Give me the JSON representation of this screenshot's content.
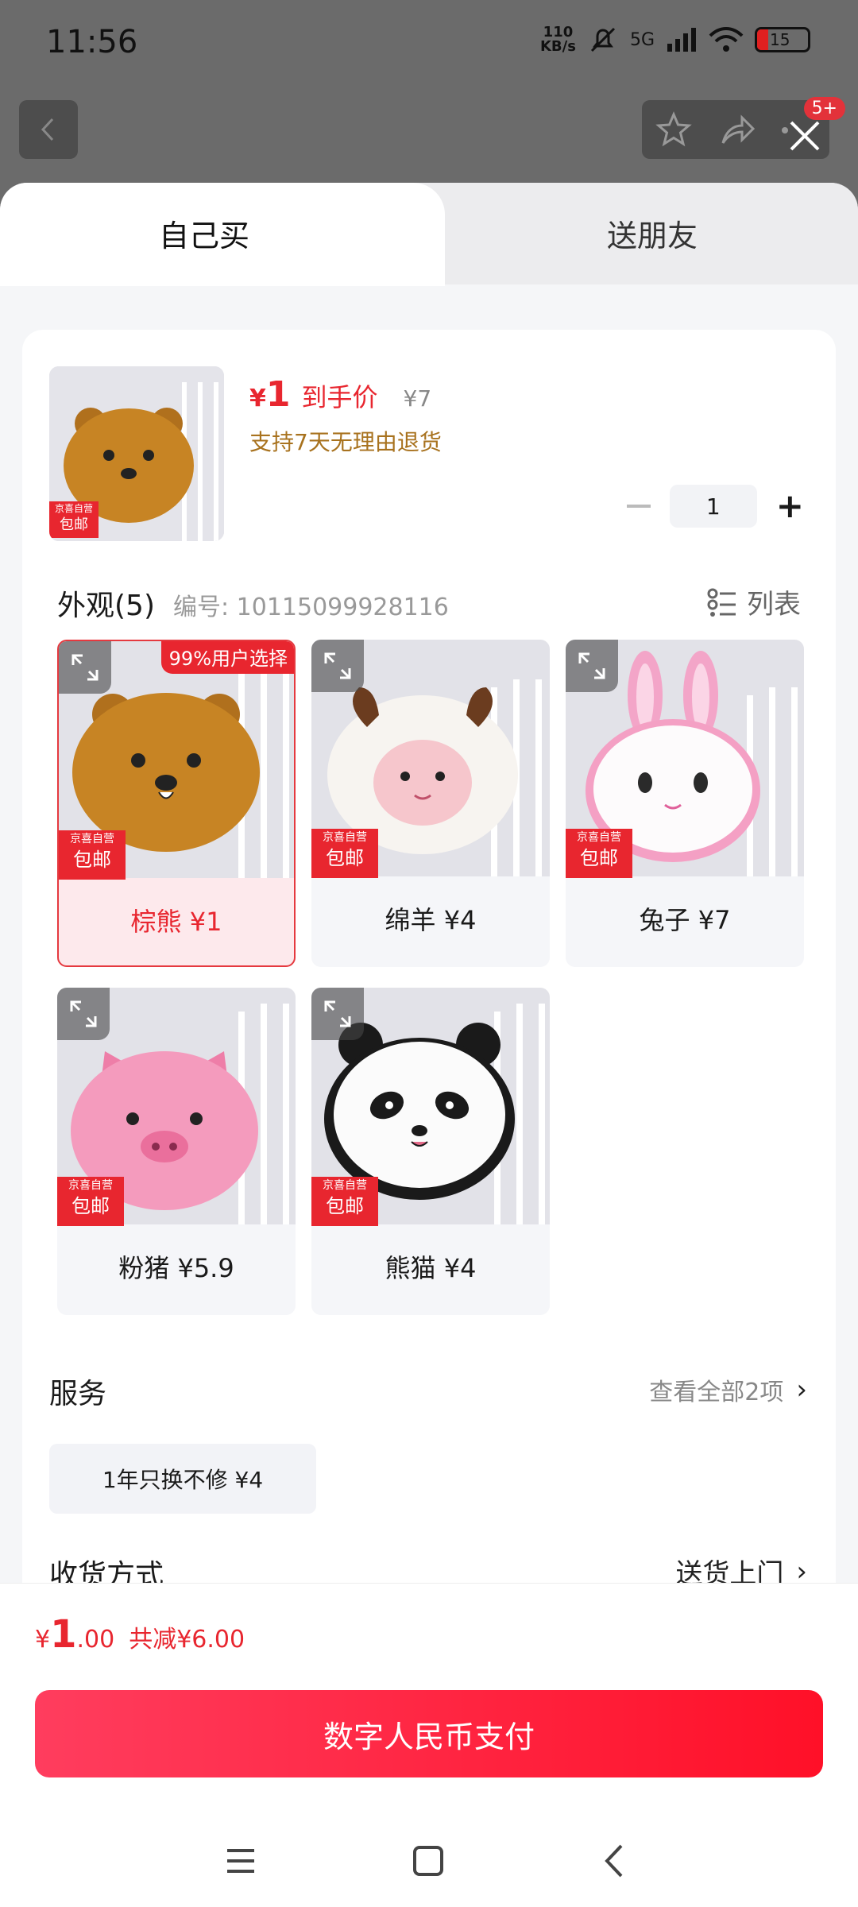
{
  "status": {
    "time": "11:56",
    "netspeed_top": "110",
    "netspeed_bottom": "KB/s",
    "signal": "5G",
    "battery": "15"
  },
  "header": {
    "badge": "5+"
  },
  "tabs": {
    "self": "自己买",
    "friend": "送朋友"
  },
  "product": {
    "price_currency": "¥",
    "price": "1",
    "price_tag": "到手价",
    "original_price": "¥7",
    "return_note": "支持7天无理由退货",
    "quantity": "1"
  },
  "variants": {
    "title": "外观(5)",
    "serial": "编号: 10115099928116",
    "list_label": "列表",
    "popular_tag": "99%用户选择",
    "ship_line1": "京喜自营",
    "ship_line2": "包邮",
    "items": [
      {
        "label": "棕熊  ¥1",
        "animal": "bear"
      },
      {
        "label": "绵羊  ¥4",
        "animal": "sheep"
      },
      {
        "label": "兔子  ¥7",
        "animal": "rabbit"
      },
      {
        "label": "粉猪  ¥5.9",
        "animal": "pig"
      },
      {
        "label": "熊猫  ¥4",
        "animal": "panda"
      }
    ]
  },
  "service": {
    "title": "服务",
    "view_all": "查看全部2项",
    "chip": "1年只换不修  ¥4"
  },
  "delivery": {
    "title": "收货方式",
    "value": "送货上门"
  },
  "footer": {
    "currency": "¥",
    "total_int": "1",
    "total_dec": ".00",
    "saved": "共减¥6.00",
    "pay_button": "数字人民币支付"
  },
  "colors": {
    "accent": "#e8262f",
    "pay_gradient_start": "#ff3d5e",
    "pay_gradient_end": "#ff1028",
    "return_note": "#a8721e"
  }
}
